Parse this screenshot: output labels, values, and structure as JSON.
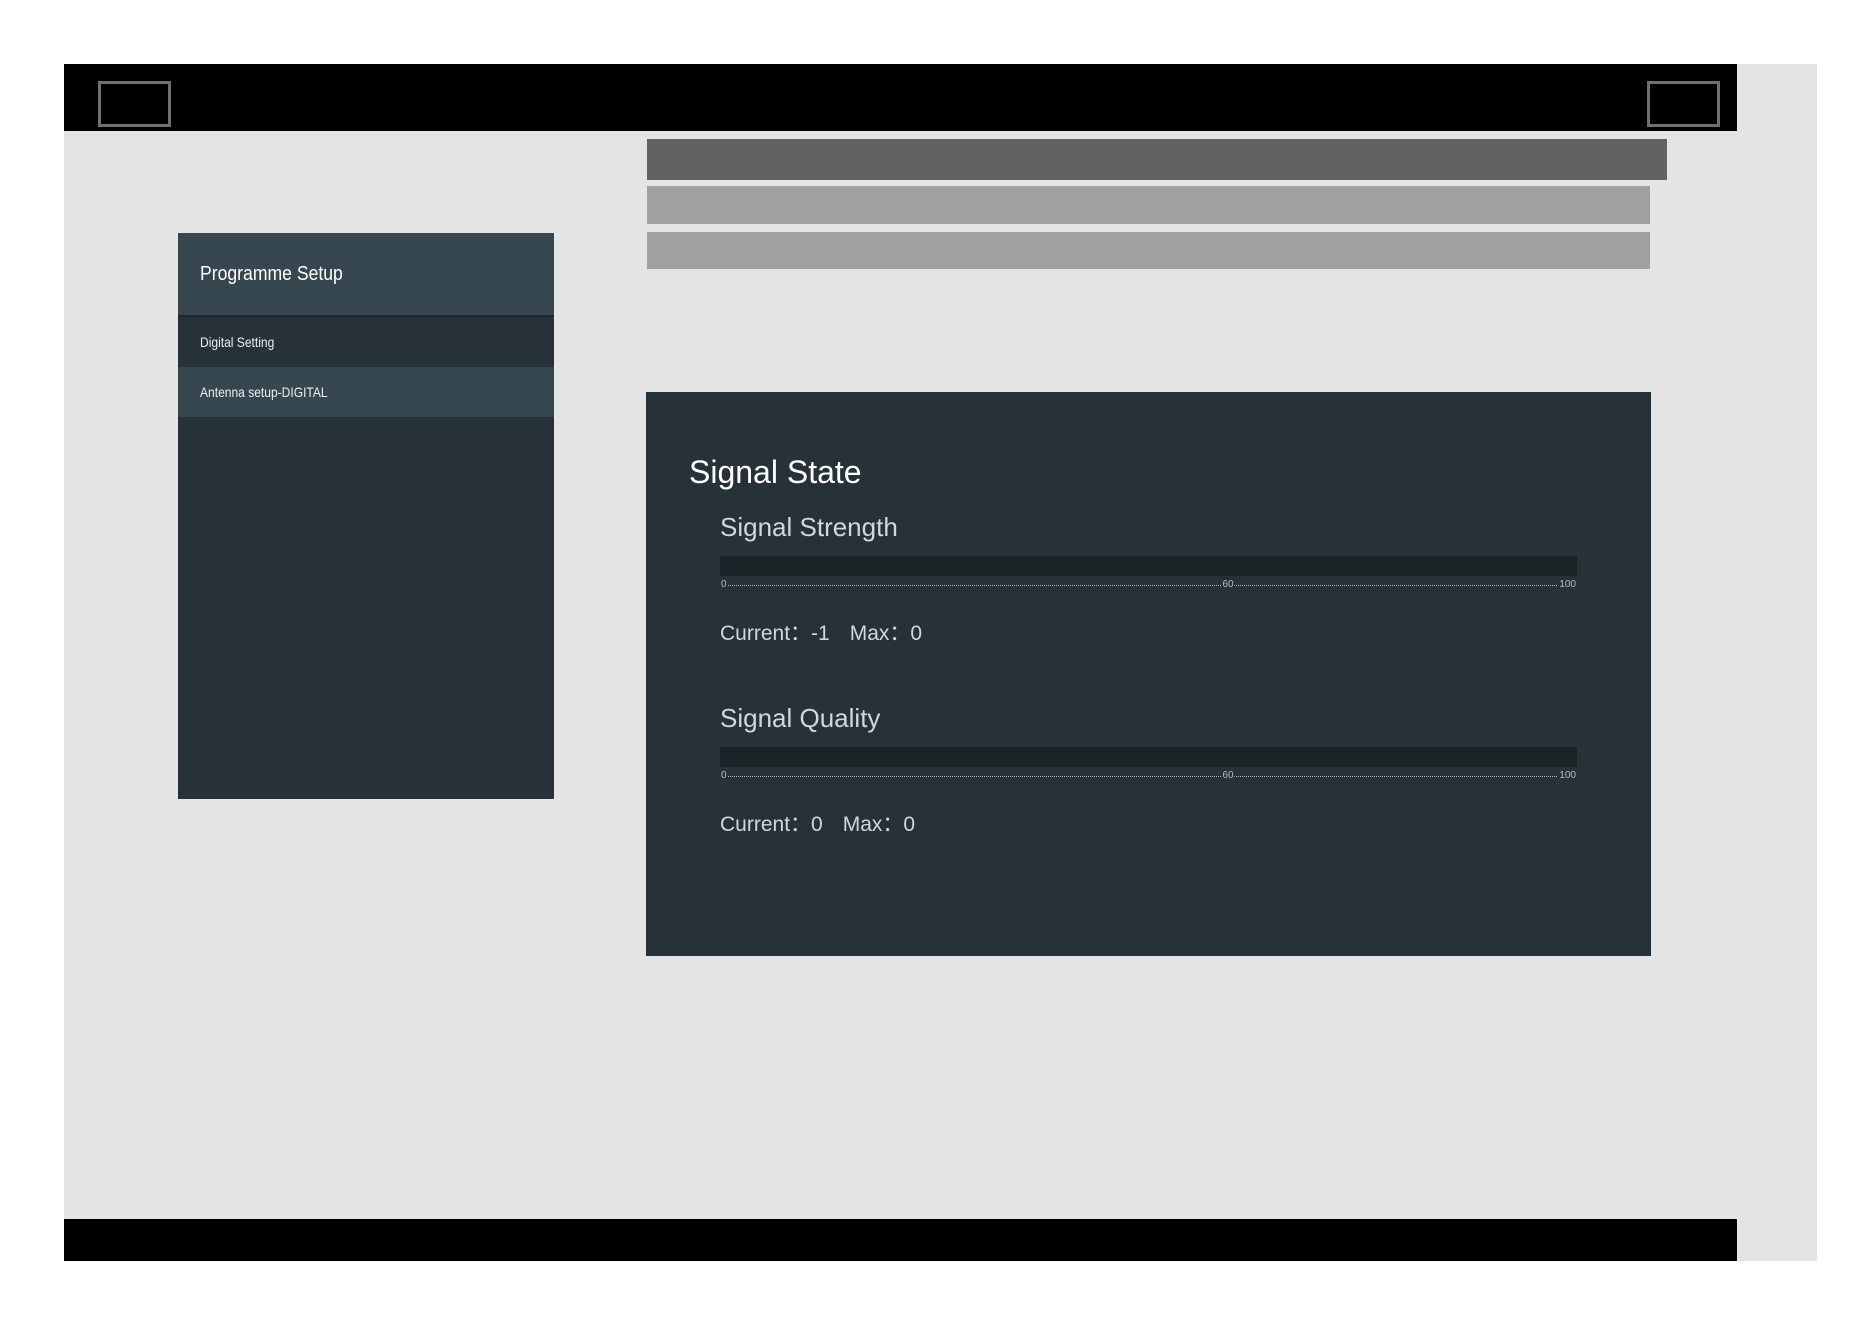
{
  "menu": {
    "title": "Programme Setup",
    "items": [
      {
        "label": "Digital Setting"
      },
      {
        "label": "Antenna setup-DIGITAL"
      }
    ]
  },
  "signal": {
    "title": "Signal State",
    "strength": {
      "title": "Signal Strength",
      "current_label": "Current",
      "current_value": "-1",
      "max_label": "Max",
      "max_value": "0",
      "level_percent": 0,
      "scale": {
        "start": "0",
        "mid": "60",
        "end": "100"
      }
    },
    "quality": {
      "title": "Signal Quality",
      "current_label": "Current",
      "current_value": "0",
      "max_label": "Max",
      "max_value": "0",
      "level_percent": 0,
      "scale": {
        "start": "0",
        "mid": "60",
        "end": "100"
      }
    }
  },
  "colors": {
    "screen_background": "#e4e4e4",
    "panel_background": "#263238",
    "menu_header": "#37474f",
    "menu_selected": "#37474f",
    "bar_frame": "#000000"
  }
}
